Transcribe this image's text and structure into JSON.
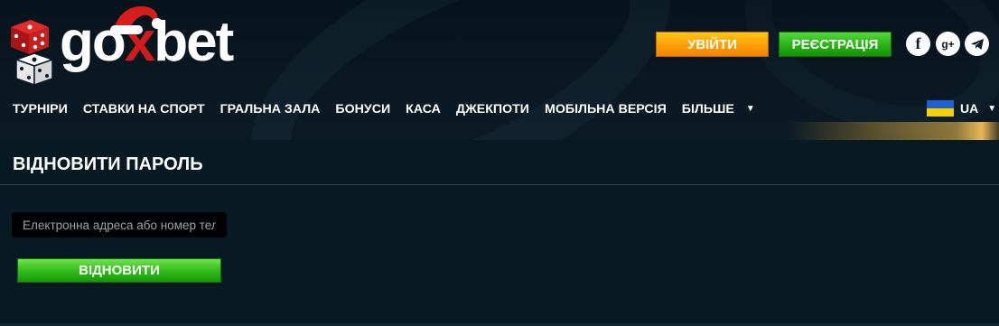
{
  "header": {
    "logo": {
      "text_prefix": "go",
      "text_x": "x",
      "text_suffix": "bet"
    },
    "login_label": "УВІЙТИ",
    "register_label": "РЕЄСТРАЦІЯ",
    "social": [
      {
        "name": "facebook",
        "glyph": "f"
      },
      {
        "name": "google-plus",
        "glyph": "g+"
      },
      {
        "name": "telegram",
        "glyph": ""
      }
    ]
  },
  "nav": {
    "items": [
      {
        "label": "ТУРНІРИ"
      },
      {
        "label": "СТАВКИ НА СПОРТ"
      },
      {
        "label": "ГРАЛЬНА ЗАЛА"
      },
      {
        "label": "БОНУСИ"
      },
      {
        "label": "КАСА"
      },
      {
        "label": "ДЖЕКПОТИ"
      },
      {
        "label": "МОБІЛЬНА ВЕРСІЯ"
      }
    ],
    "more_label": "БІЛЬШЕ",
    "language": {
      "code": "UA"
    }
  },
  "main": {
    "title": "ВІДНОВИТИ ПАРОЛЬ",
    "input": {
      "placeholder": "Електронна адреса або номер телефону",
      "value": ""
    },
    "submit_label": "ВІДНОВИТИ"
  },
  "colors": {
    "background": "#0b1a25",
    "login_button": "#ff9d06",
    "register_button": "#27b214",
    "restore_button": "#2fb81a",
    "logo_accent": "#d21c1c"
  }
}
